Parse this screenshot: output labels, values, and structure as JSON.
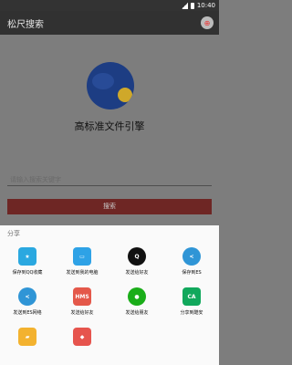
{
  "status": {
    "time": "10:40"
  },
  "appbar": {
    "title": "松尺搜索"
  },
  "main": {
    "app_title": "高标准文件引擎",
    "search_placeholder": "请输入搜索关键字",
    "search_button": "搜索"
  },
  "sheet": {
    "title": "分享",
    "items": [
      {
        "label": "保存到QQ收藏",
        "icon": "qq-star-icon",
        "color": "#2aa8e0",
        "text": "★"
      },
      {
        "label": "发送到我的电脑",
        "icon": "computer-icon",
        "color": "#2ea2e6",
        "text": "▭"
      },
      {
        "label": "发送给好友",
        "icon": "qq-icon",
        "color": "#111111",
        "text": "Q"
      },
      {
        "label": "保存到ES",
        "icon": "es-share-icon",
        "color": "#2f95d6",
        "text": "<"
      },
      {
        "label": "发送到ES网络",
        "icon": "es-network-icon",
        "color": "#2f95d6",
        "text": "<"
      },
      {
        "label": "发送给好友",
        "icon": "hms-icon",
        "color": "#e4584a",
        "text": "HMS"
      },
      {
        "label": "发送给朋友",
        "icon": "wechat-icon",
        "color": "#1aad19",
        "text": "●"
      },
      {
        "label": "分享到酷安",
        "icon": "coolapk-icon",
        "color": "#11a85c",
        "text": "CA"
      },
      {
        "label": "",
        "icon": "folder-icon",
        "color": "#f3b22f",
        "text": "▰"
      },
      {
        "label": "",
        "icon": "layers-icon",
        "color": "#e6544d",
        "text": "◆"
      }
    ]
  }
}
